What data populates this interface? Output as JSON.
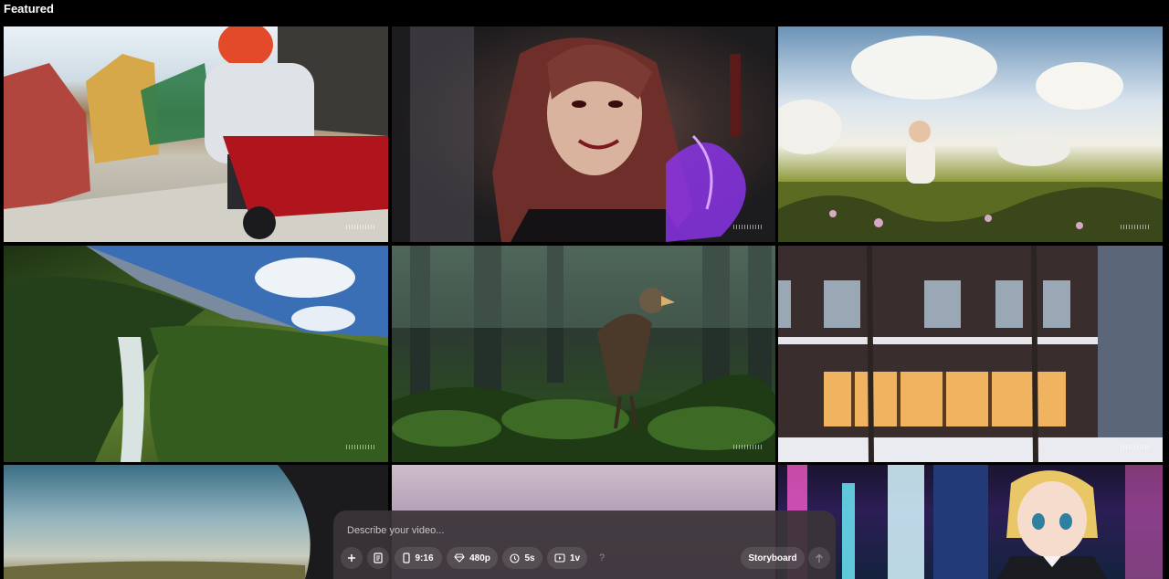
{
  "header": {
    "title": "Featured"
  },
  "gallery": {
    "tiles": [
      {
        "subject": "girl-on-scooter-city-street",
        "icon": "video-thumbnail"
      },
      {
        "subject": "vampire-guitarist",
        "icon": "video-thumbnail"
      },
      {
        "subject": "child-in-meadow",
        "icon": "video-thumbnail"
      },
      {
        "subject": "aerial-waterfall-valley",
        "icon": "video-thumbnail"
      },
      {
        "subject": "raptor-in-forest",
        "icon": "video-thumbnail"
      },
      {
        "subject": "snowy-cafe-facade",
        "icon": "video-thumbnail"
      },
      {
        "subject": "fisheye-field",
        "icon": "video-thumbnail"
      },
      {
        "subject": "dusk-sky",
        "icon": "video-thumbnail"
      },
      {
        "subject": "anime-girl-neon-city",
        "icon": "video-thumbnail"
      }
    ]
  },
  "composer": {
    "placeholder": "Describe your video...",
    "add_icon": "plus-icon",
    "template_icon": "document-icon",
    "aspect_ratio": "9:16",
    "quality": "480p",
    "duration": "5s",
    "variations": "1v",
    "help": "?",
    "storyboard_label": "Storyboard",
    "submit_icon": "arrow-up-icon"
  }
}
